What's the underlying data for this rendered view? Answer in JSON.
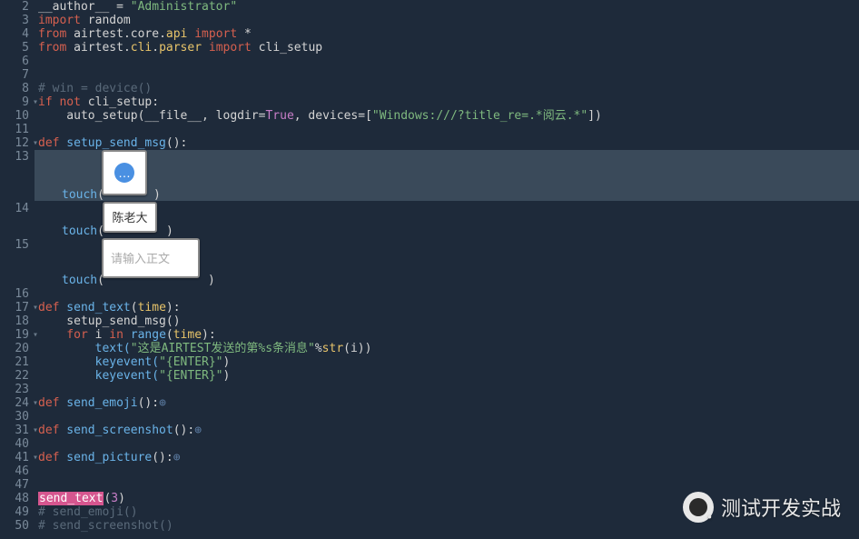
{
  "gutter": {
    "lines": [
      2,
      3,
      4,
      5,
      6,
      7,
      8,
      9,
      10,
      11,
      12,
      13,
      14,
      15,
      16,
      17,
      18,
      19,
      20,
      21,
      22,
      23,
      24,
      30,
      31,
      40,
      41,
      46,
      47,
      48,
      49,
      50
    ],
    "foldable": [
      9,
      12,
      17,
      19,
      24,
      31,
      41
    ]
  },
  "code": {
    "l2_a": "__author__ ",
    "l2_b": "=",
    "l2_c": " \"Administrator\"",
    "l3_a": "import",
    "l3_b": " random",
    "l4_a": "from",
    "l4_b": " airtest",
    "l4_c": ".",
    "l4_d": "core",
    "l4_e": ".",
    "l4_f": "api",
    "l4_g": " import",
    "l4_h": " *",
    "l5_a": "from",
    "l5_b": " airtest",
    "l5_c": ".",
    "l5_d": "cli",
    "l5_e": ".",
    "l5_f": "parser",
    "l5_g": " import",
    "l5_h": " cli_setup",
    "l8": "# win = device()",
    "l9_a": "if",
    "l9_b": " not",
    "l9_c": " cli_setup:",
    "l10_a": "    auto_setup(__file__",
    "l10_b": ",",
    "l10_c": " logdir",
    "l10_d": "=",
    "l10_e": "True",
    "l10_f": ",",
    "l10_g": " devices",
    "l10_h": "=",
    "l10_i": "[",
    "l10_j": "\"Windows:///?title_re=.*阅云.*\"",
    "l10_k": "])",
    "l12_a": "def",
    "l12_b": " setup_send_msg",
    "l12_c": "():",
    "touch": "touch",
    "l17_a": "def",
    "l17_b": " send_text",
    "l17_c": "(",
    "l17_d": "time",
    "l17_e": "):",
    "l18_a": "    setup_send_msg()",
    "l19_a": "    for",
    "l19_b": " i ",
    "l19_c": "in",
    "l19_d": " range",
    "l19_e": "(",
    "l19_f": "time",
    "l19_g": "):",
    "l20_a": "        text(",
    "l20_b": "\"这是AIRTEST发送的第%s条消息\"",
    "l20_c": "%",
    "l20_d": "str",
    "l20_e": "(i))",
    "l21_a": "        keyevent(",
    "l21_b": "\"{ENTER}\"",
    "l21_c": ")",
    "l22_a": "        keyevent(",
    "l22_b": "\"{ENTER}\"",
    "l22_c": ")",
    "l24_a": "def",
    "l24_b": " send_emoji",
    "l24_c": "():",
    "l31_a": "def",
    "l31_b": " send_screenshot",
    "l31_c": "():",
    "l41_a": "def",
    "l41_b": " send_picture",
    "l41_c": "():",
    "collapsed": "⊕",
    "l48_a": "send_text",
    "l48_b": "(",
    "l48_c": "3",
    "l48_d": ")",
    "l49": "# send_emoji()",
    "l50": "# send_screenshot()"
  },
  "thumbs": {
    "t1_alt": "chat-bubble",
    "t2_text": "陈老大",
    "t3_text": "请输入正文"
  },
  "watermark": {
    "text": "测试开发实战"
  }
}
